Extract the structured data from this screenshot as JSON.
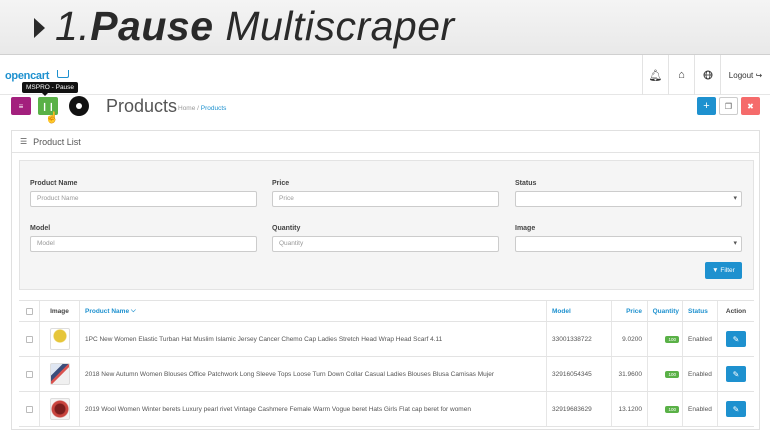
{
  "banner": {
    "number": "1.",
    "word_bold": "Pause",
    "word_rest": " Multiscraper"
  },
  "header": {
    "logo_text": "opencart",
    "logout_label": "Logout",
    "icons": [
      "bell-icon",
      "home-icon",
      "globe-icon",
      "logout-icon"
    ]
  },
  "tooltip": "MSPRO - Pause",
  "page": {
    "title": "Products",
    "breadcrumb": {
      "home": "Home",
      "separator": "/",
      "current": "Products"
    }
  },
  "panel": {
    "title": "Product List",
    "filter": {
      "product_name": {
        "label": "Product Name",
        "placeholder": "Product Name"
      },
      "price": {
        "label": "Price",
        "placeholder": "Price"
      },
      "status": {
        "label": "Status",
        "value": ""
      },
      "model": {
        "label": "Model",
        "placeholder": "Model"
      },
      "quantity": {
        "label": "Quantity",
        "placeholder": "Quantity"
      },
      "image": {
        "label": "Image",
        "value": ""
      },
      "button_label": "Filter"
    },
    "table": {
      "headers": {
        "image": "Image",
        "product_name": "Product Name",
        "model": "Model",
        "price": "Price",
        "quantity": "Quantity",
        "status": "Status",
        "action": "Action"
      },
      "rows": [
        {
          "name": "1PC New Women Elastic Turban Hat Muslim Islamic Jersey Cancer Chemo Cap Ladies Stretch Head Wrap Head Scarf 4.11",
          "model": "33001338722",
          "price": "9.0200",
          "quantity": "100",
          "status": "Enabled"
        },
        {
          "name": "2018 New Autumn Women Blouses Office Patchwork Long Sleeve Tops Loose Turn Down Collar Casual Ladies Blouses Blusa Camisas Mujer",
          "model": "32916054345",
          "price": "31.9600",
          "quantity": "100",
          "status": "Enabled"
        },
        {
          "name": "2019 Wool Women Winter berets Luxury pearl rivet Vintage Cashmere Female Warm Vogue beret Hats Girls Flat cap beret for women",
          "model": "32919683629",
          "price": "13.1200",
          "quantity": "100",
          "status": "Enabled"
        }
      ]
    }
  },
  "colors": {
    "accent": "#1e91cf",
    "green": "#5ab147",
    "purple": "#a3207d",
    "red": "#f56b6b"
  }
}
